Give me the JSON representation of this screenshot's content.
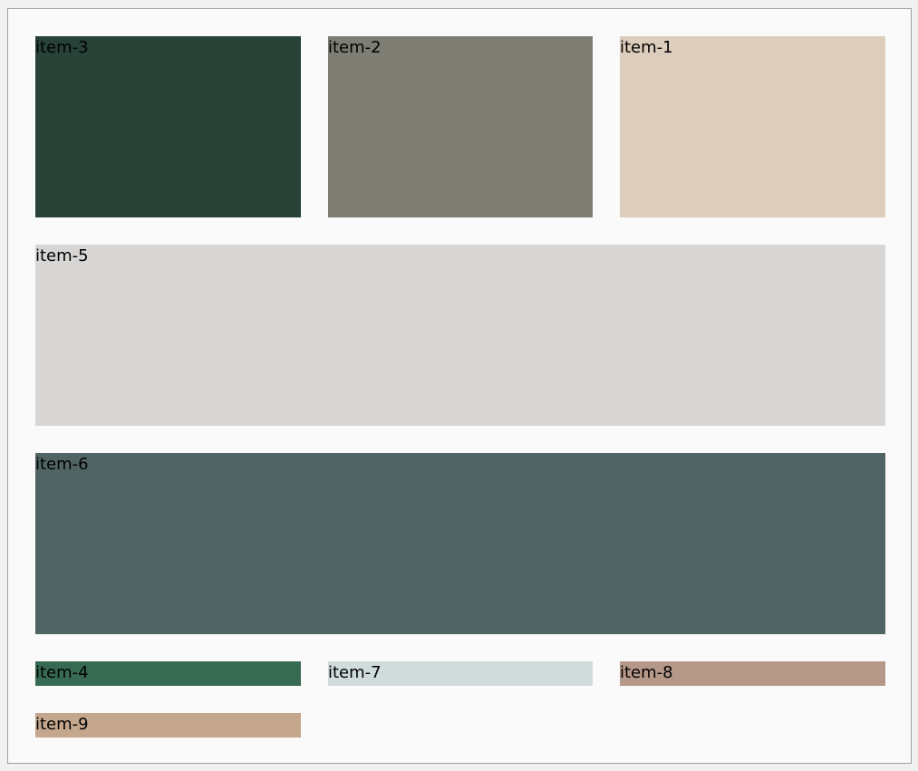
{
  "items": [
    {
      "id": "it-3",
      "label": "item-3",
      "color": "#284238"
    },
    {
      "id": "it-2",
      "label": "item-2",
      "color": "#7e7e74"
    },
    {
      "id": "it-1",
      "label": "item-1",
      "color": "#ddcdbc"
    },
    {
      "id": "it-5",
      "label": "item-5",
      "color": "#d7d6d4"
    },
    {
      "id": "it-6",
      "label": "item-6",
      "color": "#506563"
    },
    {
      "id": "it-4",
      "label": "item-4",
      "color": "#376a52"
    },
    {
      "id": "it-7",
      "label": "item-7",
      "color": "#d0dbdb"
    },
    {
      "id": "it-8",
      "label": "item-8",
      "color": "#b69888"
    },
    {
      "id": "it-9",
      "label": "item-9",
      "color": "#c4a78d"
    }
  ]
}
